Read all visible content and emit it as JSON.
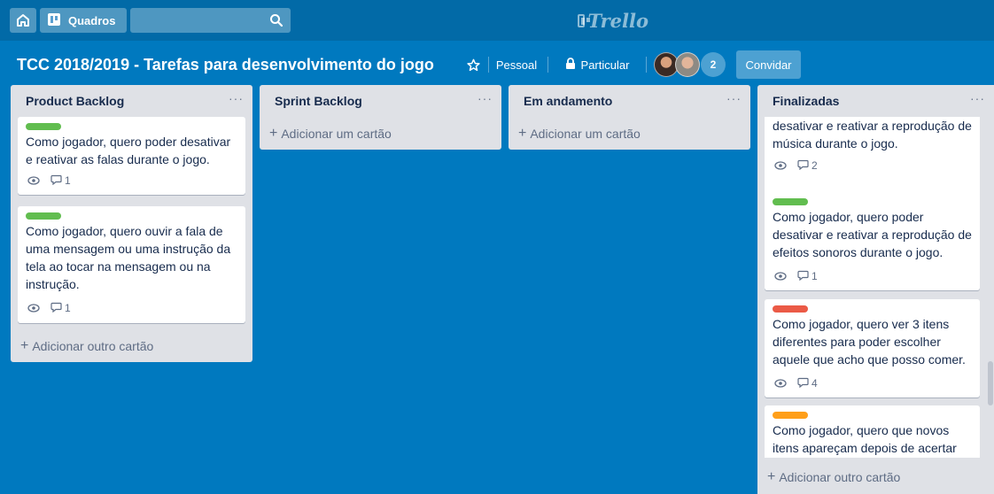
{
  "topbar": {
    "home_icon": "home-icon",
    "boards_label": "Quadros",
    "boards_icon": "boards-icon",
    "search_icon": "search-icon",
    "logo_text": "Trello"
  },
  "board": {
    "title": "TCC 2018/2019 - Tarefas para desenvolvimento do jogo",
    "team_label": "Pessoal",
    "visibility_label": "Particular",
    "member_count": "2",
    "invite_label": "Convidar"
  },
  "lists": [
    {
      "title": "Product Backlog",
      "add_label": "Adicionar outro cartão",
      "cards": [
        {
          "label_color": "#61bd4f",
          "text": "Como jogador, quero poder desativar e reativar as falas durante o jogo.",
          "comments": "1"
        },
        {
          "label_color": "#61bd4f",
          "text": "Como jogador, quero ouvir a fala de uma mensagem ou uma instrução da tela ao tocar na mensagem ou na instrução.",
          "comments": "1"
        }
      ]
    },
    {
      "title": "Sprint Backlog",
      "add_label": "Adicionar um cartão",
      "cards": []
    },
    {
      "title": "Em andamento",
      "add_label": "Adicionar um cartão",
      "cards": []
    },
    {
      "title": "Finalizadas",
      "add_label": "Adicionar outro cartão",
      "cards": [
        {
          "label_color": "#61bd4f",
          "text": "desativar e reativar a reprodução de música durante o jogo.",
          "comments": "2"
        },
        {
          "label_color": "#61bd4f",
          "text": "Como jogador, quero poder desativar e reativar a reprodução de efeitos sonoros durante o jogo.",
          "comments": "1"
        },
        {
          "label_color": "#eb5a46",
          "text": "Como jogador, quero ver 3 itens diferentes para poder escolher aquele que acho que posso comer.",
          "comments": "4"
        },
        {
          "label_color": "#ff9f1a",
          "text": "Como jogador, quero que novos itens apareçam depois de acertar um",
          "comments": ""
        }
      ]
    }
  ],
  "menu_glyph": "···",
  "plus_glyph": "+"
}
